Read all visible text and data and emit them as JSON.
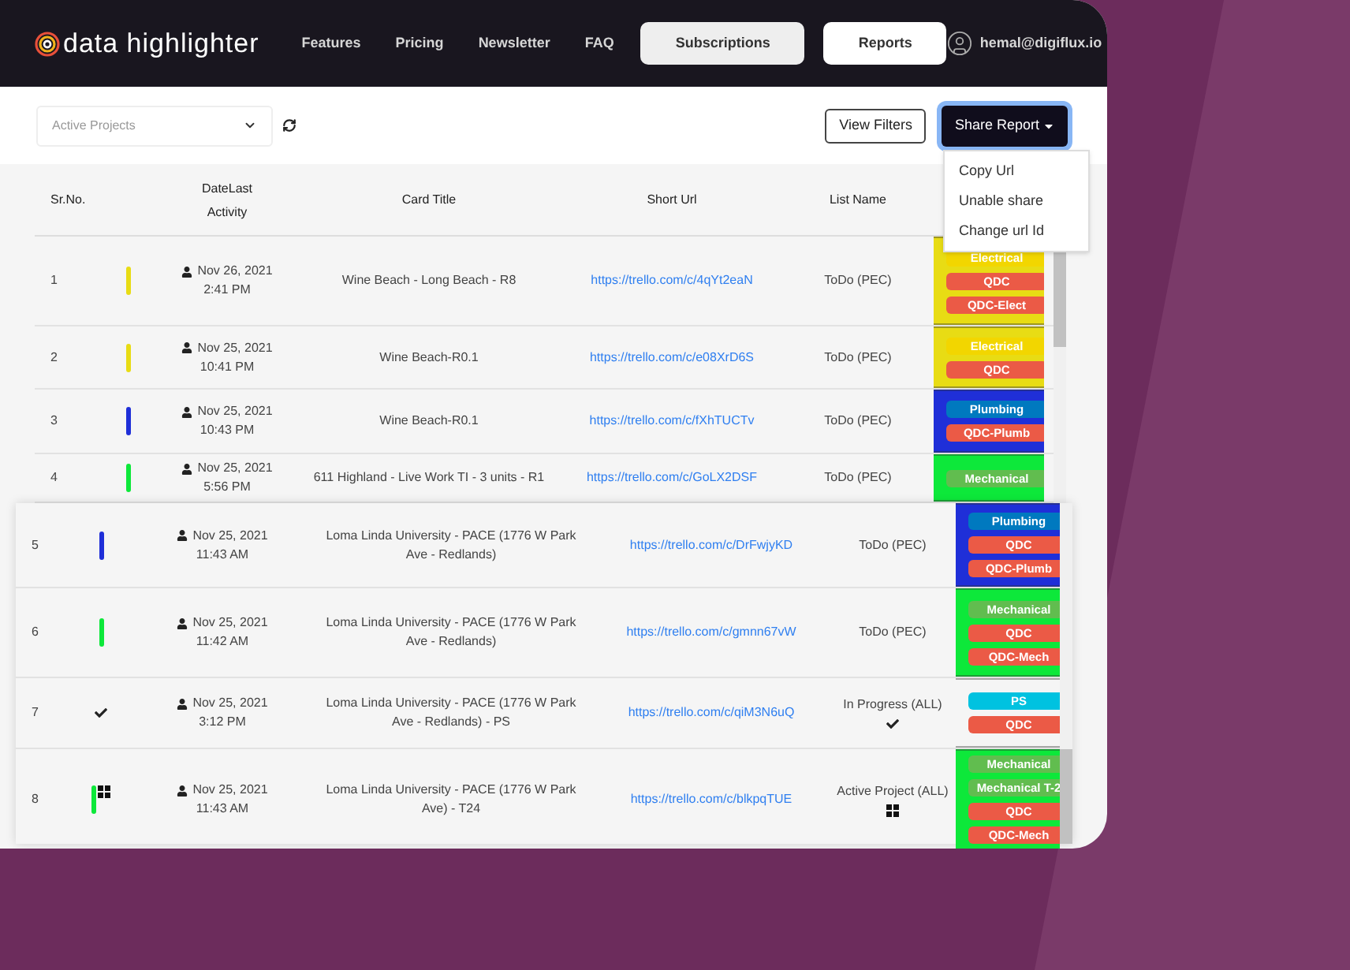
{
  "header": {
    "logo": "data highlighter",
    "nav": [
      {
        "label": "Features",
        "kind": "link"
      },
      {
        "label": "Pricing",
        "kind": "link"
      },
      {
        "label": "Newsletter",
        "kind": "link"
      },
      {
        "label": "FAQ",
        "kind": "link"
      },
      {
        "label": "Subscriptions",
        "kind": "button",
        "selected": false
      },
      {
        "label": "Reports",
        "kind": "button",
        "selected": true
      }
    ],
    "user": "hemal@digiflux.io"
  },
  "toolbar": {
    "project_select": {
      "placeholder": "Active Projects"
    },
    "view_filters": "View Filters",
    "share_report": "Share Report",
    "share_menu": {
      "expanded": true,
      "items": [
        "Copy Url",
        "Unable share",
        "Change url Id"
      ]
    }
  },
  "table": {
    "columns": [
      "Sr.No.",
      "DateLast Activity",
      "Card Title",
      "Short Url",
      "List Name"
    ],
    "rows": [
      {
        "no": "1",
        "kind": "bar",
        "color": "#e8dc14",
        "date": "Nov 26, 2021",
        "time": "2:41 PM",
        "title": "Wine Beach - Long Beach - R8",
        "url": "https://trello.com/c/4qYt2eaN",
        "list": "ToDo (PEC)",
        "labels": [
          {
            "text": "Electrical",
            "color": "#f2d600"
          },
          {
            "text": "QDC",
            "color": "#eb5a46"
          },
          {
            "text": "QDC-Elect",
            "color": "#eb5a46"
          }
        ]
      },
      {
        "no": "2",
        "kind": "bar",
        "color": "#e8dc14",
        "date": "Nov 25, 2021",
        "time": "10:41 PM",
        "title": "Wine Beach-R0.1",
        "url": "https://trello.com/c/e08XrD6S",
        "list": "ToDo (PEC)",
        "labels": [
          {
            "text": "Electrical",
            "color": "#f2d600"
          },
          {
            "text": "QDC",
            "color": "#eb5a46"
          }
        ]
      },
      {
        "no": "3",
        "kind": "bar",
        "color": "#1f2fd8",
        "date": "Nov 25, 2021",
        "time": "10:43 PM",
        "title": "Wine Beach-R0.1",
        "url": "https://trello.com/c/fXhTUCTv",
        "list": "ToDo (PEC)",
        "labels": [
          {
            "text": "Plumbing",
            "color": "#0079bf"
          },
          {
            "text": "QDC-Plumb",
            "color": "#eb5a46"
          }
        ]
      },
      {
        "no": "4",
        "kind": "bar",
        "color": "#0de83a",
        "date": "Nov 25, 2021",
        "time": "5:56 PM",
        "title": "611 Highland - Live Work TI - 3 units - R1",
        "url": "https://trello.com/c/GoLX2DSF",
        "list": "ToDo (PEC)",
        "labels": [
          {
            "text": "Mechanical",
            "color": "#61bd4f"
          }
        ]
      },
      {
        "no": "5",
        "kind": "bar",
        "color": "#1f2fd8",
        "date": "Nov 25, 2021",
        "time": "11:43 AM",
        "title": "Loma Linda University - PACE (1776 W Park Ave - Redlands)",
        "url": "https://trello.com/c/DrFwjyKD",
        "list": "ToDo (PEC)",
        "labels": [
          {
            "text": "Plumbing",
            "color": "#0079bf"
          },
          {
            "text": "QDC",
            "color": "#eb5a46"
          },
          {
            "text": "QDC-Plumb",
            "color": "#eb5a46"
          }
        ]
      },
      {
        "no": "6",
        "kind": "bar",
        "color": "#0de83a",
        "date": "Nov 25, 2021",
        "time": "11:42 AM",
        "title": "Loma Linda University - PACE (1776 W Park Ave - Redlands)",
        "url": "https://trello.com/c/gmnn67vW",
        "list": "ToDo (PEC)",
        "labels": [
          {
            "text": "Mechanical",
            "color": "#61bd4f"
          },
          {
            "text": "QDC",
            "color": "#eb5a46"
          },
          {
            "text": "QDC-Mech",
            "color": "#eb5a46"
          }
        ]
      },
      {
        "no": "7",
        "kind": "check",
        "date": "Nov 25, 2021",
        "time": "3:12 PM",
        "title": "Loma Linda University - PACE (1776 W Park Ave - Redlands) - PS",
        "url": "https://trello.com/c/qiM3N6uQ",
        "list": "In Progress (ALL)",
        "list_icon": {
          "kind": "check"
        },
        "labels": [
          {
            "text": "PS",
            "color": "#00c2e0"
          },
          {
            "text": "QDC",
            "color": "#eb5a46"
          }
        ]
      },
      {
        "no": "8",
        "kind": "bar_grid",
        "color": "#0de83a",
        "date": "Nov 25, 2021",
        "time": "11:43 AM",
        "title": "Loma Linda University - PACE (1776 W Park Ave) - T24",
        "url": "https://trello.com/c/blkpqTUE",
        "list": "Active Project (ALL)",
        "list_icon": {
          "kind": "grid"
        },
        "labels": [
          {
            "text": "Mechanical",
            "color": "#61bd4f"
          },
          {
            "text": "Mechanical T-2",
            "color": "#61bd4f"
          },
          {
            "text": "QDC",
            "color": "#eb5a46"
          },
          {
            "text": "QDC-Mech",
            "color": "#eb5a46"
          }
        ]
      }
    ]
  }
}
